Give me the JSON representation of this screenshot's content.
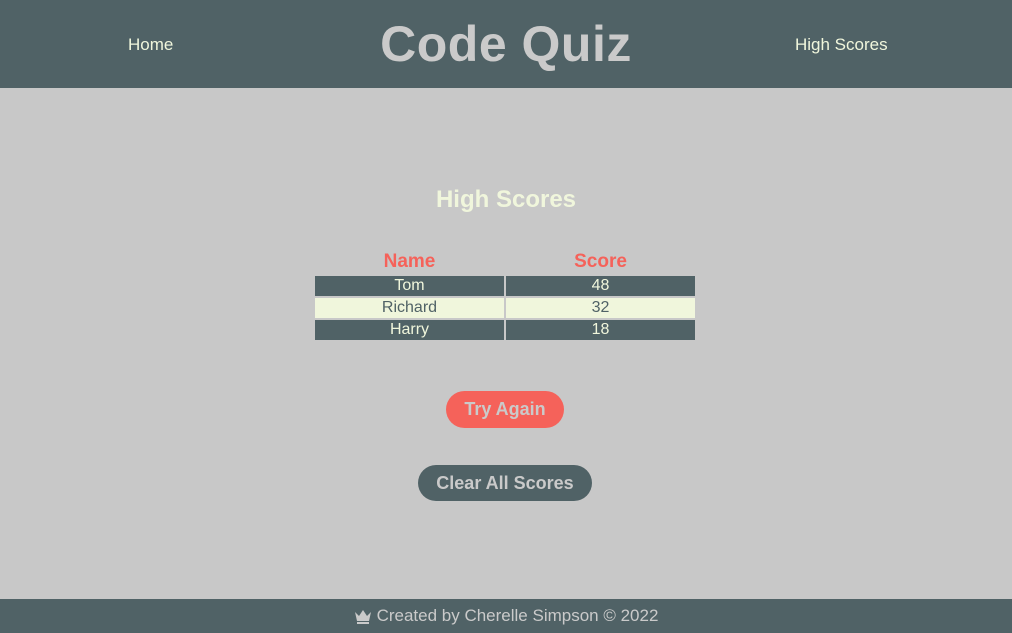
{
  "header": {
    "nav_home": "Home",
    "title": "Code Quiz",
    "nav_high_scores": "High Scores"
  },
  "main": {
    "heading": "High Scores",
    "table": {
      "columns": [
        "Name",
        "Score"
      ],
      "rows": [
        {
          "name": "Tom",
          "score": "48"
        },
        {
          "name": "Richard",
          "score": "32"
        },
        {
          "name": "Harry",
          "score": "18"
        }
      ]
    },
    "try_again_label": "Try Again",
    "clear_scores_label": "Clear All Scores"
  },
  "footer": {
    "icon": "crown-icon",
    "text": "Created by Cherelle Simpson © 2022"
  },
  "colors": {
    "header_bg": "#506266",
    "page_bg": "#c8c8c8",
    "accent": "#f5625a",
    "light_text": "#f0f6dc",
    "title_text": "#cacaca"
  }
}
